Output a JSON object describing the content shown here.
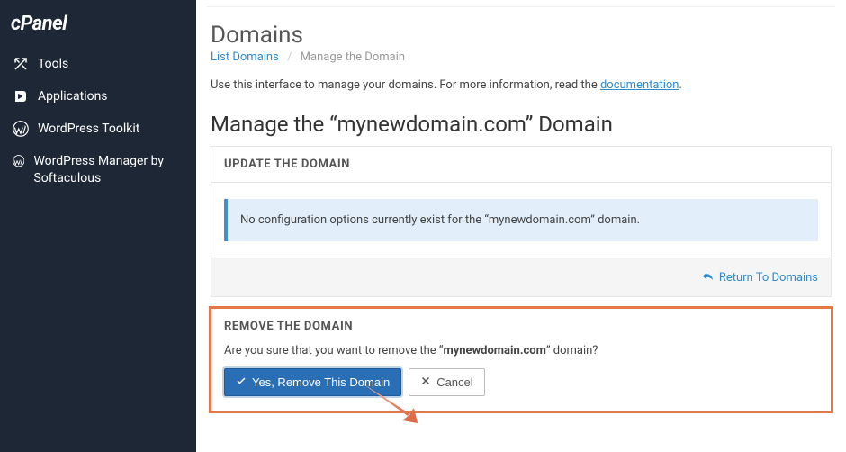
{
  "sidebar": {
    "logo": "cPanel",
    "items": [
      {
        "label": "Tools"
      },
      {
        "label": "Applications"
      },
      {
        "label": "WordPress Toolkit"
      },
      {
        "label": "WordPress Manager by Softaculous"
      }
    ]
  },
  "page": {
    "title": "Domains",
    "breadcrumbs": {
      "root": "List Domains",
      "current": "Manage the Domain"
    },
    "intro_prefix": "Use this interface to manage your domains. For more information, read the ",
    "intro_link": "documentation",
    "intro_suffix": ".",
    "heading2": "Manage the “mynewdomain.com” Domain"
  },
  "update_card": {
    "title": "UPDATE THE DOMAIN",
    "info": "No configuration options currently exist for the “mynewdomain.com” domain.",
    "return_link": "Return To Domains"
  },
  "remove_card": {
    "title": "REMOVE THE DOMAIN",
    "confirm_prefix": "Are you sure that you want to remove the “",
    "confirm_bold": "mynewdomain.com",
    "confirm_suffix": "” domain?",
    "yes_btn": "Yes, Remove This Domain",
    "cancel_btn": "Cancel"
  }
}
